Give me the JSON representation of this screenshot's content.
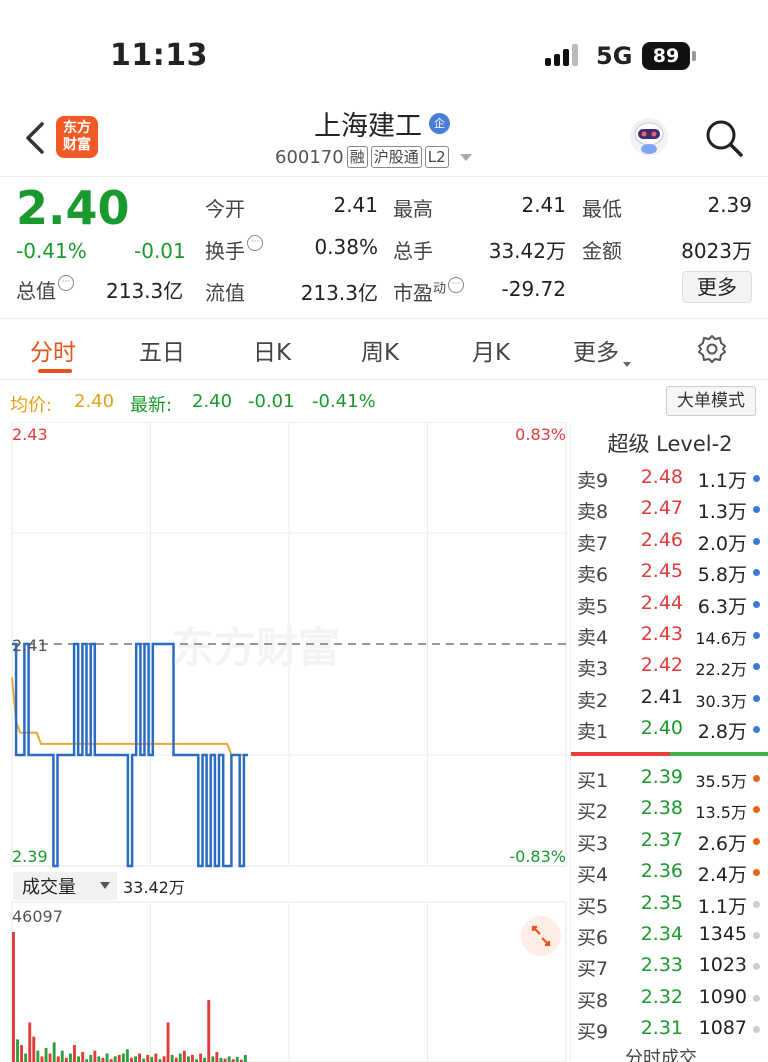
{
  "status_bar": {
    "time": "11:13",
    "network": "5G",
    "battery": "89"
  },
  "header": {
    "logo_line1": "东方",
    "logo_line2": "财富",
    "stock_name": "上海建工",
    "badge": "企",
    "code": "600170",
    "tags": [
      "融",
      "沪股通",
      "L2"
    ]
  },
  "quote": {
    "price": "2.40",
    "change_pct": "-0.41%",
    "change_abs": "-0.01",
    "market_value_label": "总值",
    "market_value": "213.3亿",
    "fields": [
      {
        "label": "今开",
        "value": "2.41"
      },
      {
        "label": "最高",
        "value": "2.41"
      },
      {
        "label": "最低",
        "value": "2.39"
      },
      {
        "label": "换手",
        "value": "0.38%"
      },
      {
        "label": "总手",
        "value": "33.42万"
      },
      {
        "label": "金额",
        "value": "8023万"
      },
      {
        "label": "流值",
        "value": "213.3亿"
      },
      {
        "label": "市盈",
        "label_sup": "动",
        "value": "-29.72"
      }
    ],
    "more_label": "更多"
  },
  "tabs": [
    {
      "label": "分时",
      "active": true
    },
    {
      "label": "五日"
    },
    {
      "label": "日K"
    },
    {
      "label": "周K"
    },
    {
      "label": "月K"
    },
    {
      "label": "更多"
    }
  ],
  "avg_row": {
    "avg_label": "均价:",
    "avg_value": "2.40",
    "last_label": "最新:",
    "last_value": "2.40",
    "last_change": "-0.01",
    "last_pct": "-0.41%",
    "mode_button": "大单模式"
  },
  "chart_data": {
    "type": "line",
    "y_top_label": "2.43",
    "y_mid_label": "2.41",
    "y_bottom_label": "2.39",
    "pct_top_label": "0.83%",
    "pct_bottom_label": "-0.83%",
    "ylim": [
      2.39,
      2.43
    ],
    "prev_close": 2.41,
    "watermark": "东方财富",
    "series": [
      {
        "values": [
          2.41,
          2.4,
          2.4,
          2.41,
          2.4,
          2.4,
          2.4,
          2.4,
          2.4,
          2.4,
          2.39,
          2.4,
          2.4,
          2.4,
          2.4,
          2.41,
          2.4,
          2.41,
          2.4,
          2.41,
          2.4,
          2.4,
          2.4,
          2.4,
          2.4,
          2.4,
          2.4,
          2.4,
          2.39,
          2.4,
          2.41,
          2.4,
          2.41,
          2.4,
          2.41,
          2.41,
          2.41,
          2.41,
          2.41,
          2.4,
          2.4,
          2.4,
          2.4,
          2.4,
          2.4,
          2.39,
          2.4,
          2.39,
          2.4,
          2.39,
          2.4,
          2.39,
          2.39,
          2.4,
          2.4,
          2.39,
          2.4,
          2.4
        ]
      },
      {
        "values": [
          2.407,
          2.403,
          2.402,
          2.402,
          2.402,
          2.402,
          2.402,
          2.401,
          2.401,
          2.401,
          2.401,
          2.401,
          2.401,
          2.401,
          2.401,
          2.401,
          2.401,
          2.401,
          2.401,
          2.401,
          2.401,
          2.401,
          2.401,
          2.401,
          2.401,
          2.401,
          2.401,
          2.401,
          2.401,
          2.401,
          2.401,
          2.401,
          2.401,
          2.401,
          2.401,
          2.401,
          2.401,
          2.401,
          2.401,
          2.401,
          2.401,
          2.401,
          2.401,
          2.401,
          2.401,
          2.401,
          2.401,
          2.401,
          2.401,
          2.401,
          2.401,
          2.401,
          2.401,
          2.4,
          2.4,
          2.4,
          2.4,
          2.4
        ]
      }
    ],
    "volume": {
      "label": "成交量",
      "total": "33.42万",
      "max_label": "46097",
      "max": 46097,
      "bars": [
        46097,
        8000,
        6000,
        3000,
        14000,
        9000,
        4000,
        2000,
        5000,
        3000,
        7000,
        2000,
        4000,
        1500,
        3000,
        6000,
        2000,
        3500,
        1000,
        2500,
        4000,
        2000,
        1500,
        3000,
        1000,
        2000,
        2500,
        3000,
        4500,
        1500,
        2000,
        3000,
        1200,
        2500,
        1800,
        3000,
        1000,
        2000,
        14000,
        2500,
        1500,
        3000,
        4000,
        2000,
        2500,
        1000,
        3000,
        1500,
        22000,
        2000,
        3500,
        1500,
        1200,
        2000,
        1000,
        1800,
        800,
        2500
      ],
      "colors": [
        "r",
        "g",
        "r",
        "g",
        "r",
        "r",
        "g",
        "r",
        "g",
        "r",
        "g",
        "r",
        "g",
        "r",
        "g",
        "r",
        "g",
        "r",
        "g",
        "g",
        "r",
        "g",
        "r",
        "g",
        "r",
        "g",
        "r",
        "g",
        "g",
        "r",
        "g",
        "r",
        "g",
        "r",
        "g",
        "r",
        "g",
        "r",
        "r",
        "g",
        "r",
        "g",
        "r",
        "g",
        "r",
        "g",
        "r",
        "g",
        "r",
        "g",
        "r",
        "g",
        "r",
        "g",
        "r",
        "g",
        "r",
        "g"
      ]
    }
  },
  "order_book": {
    "title": "超级 Level-2",
    "asks": [
      {
        "label": "卖9",
        "price": "2.48",
        "vol": "1.1万",
        "color": "red"
      },
      {
        "label": "卖8",
        "price": "2.47",
        "vol": "1.3万",
        "color": "red"
      },
      {
        "label": "卖7",
        "price": "2.46",
        "vol": "2.0万",
        "color": "red"
      },
      {
        "label": "卖6",
        "price": "2.45",
        "vol": "5.8万",
        "color": "red"
      },
      {
        "label": "卖5",
        "price": "2.44",
        "vol": "6.3万",
        "color": "red"
      },
      {
        "label": "卖4",
        "price": "2.43",
        "vol": "14.6万",
        "color": "red"
      },
      {
        "label": "卖3",
        "price": "2.42",
        "vol": "22.2万",
        "color": "red"
      },
      {
        "label": "卖2",
        "price": "2.41",
        "vol": "30.3万",
        "color": "dark"
      },
      {
        "label": "卖1",
        "price": "2.40",
        "vol": "2.8万",
        "color": "green"
      }
    ],
    "bids": [
      {
        "label": "买1",
        "price": "2.39",
        "vol": "35.5万",
        "color": "green"
      },
      {
        "label": "买2",
        "price": "2.38",
        "vol": "13.5万",
        "color": "green"
      },
      {
        "label": "买3",
        "price": "2.37",
        "vol": "2.6万",
        "color": "green"
      },
      {
        "label": "买4",
        "price": "2.36",
        "vol": "2.4万",
        "color": "green"
      },
      {
        "label": "买5",
        "price": "2.35",
        "vol": "1.1万",
        "color": "green"
      },
      {
        "label": "买6",
        "price": "2.34",
        "vol": "1345",
        "color": "green"
      },
      {
        "label": "买7",
        "price": "2.33",
        "vol": "1023",
        "color": "green"
      },
      {
        "label": "买8",
        "price": "2.32",
        "vol": "1090",
        "color": "green"
      },
      {
        "label": "买9",
        "price": "2.31",
        "vol": "1087",
        "color": "green"
      }
    ],
    "ask_dot_color": "#3b7bd6",
    "bid_dot_colors": [
      "#e8641b",
      "#e8641b",
      "#e8641b",
      "#e8641b",
      "#cccccc",
      "#cccccc",
      "#cccccc",
      "#cccccc",
      "#cccccc"
    ],
    "footer": "分时成交"
  }
}
